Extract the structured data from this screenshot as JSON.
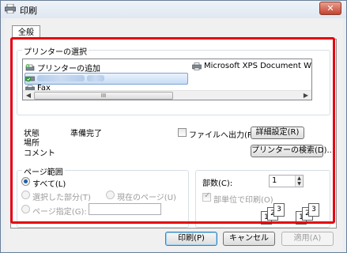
{
  "window": {
    "title": "印刷",
    "close": "✕"
  },
  "tab": {
    "label": "全般"
  },
  "printer_select": {
    "group_label": "プリンターの選択",
    "add_printer": "プリンターの追加",
    "xps": "Microsoft XPS Document Write",
    "fax": "Fax",
    "scroll_left": "◀",
    "scroll_right": "▶",
    "thumb_grip": "III"
  },
  "status": {
    "status_label": "状態",
    "status_value": "準備完了",
    "location_label": "場所",
    "comment_label": "コメント",
    "print_to_file": "ファイルへ出力(F)",
    "preferences_button": "詳細設定(R)",
    "find_printer_button": "プリンターの検索(D)..."
  },
  "page_range": {
    "group_label": "ページ範囲",
    "all": "すべて(L)",
    "selection": "選択した部分(T)",
    "current_page": "現在のページ(U)",
    "pages": "ページ指定(G):",
    "pages_value": ""
  },
  "copies": {
    "label": "部数(C):",
    "value": "1",
    "collate": "部単位で印刷(O)",
    "collate_pages": [
      "1",
      "2",
      "3"
    ]
  },
  "footer": {
    "print_button": "印刷(P)",
    "cancel_button": "キャンセル",
    "apply_button": "適用(A)"
  }
}
